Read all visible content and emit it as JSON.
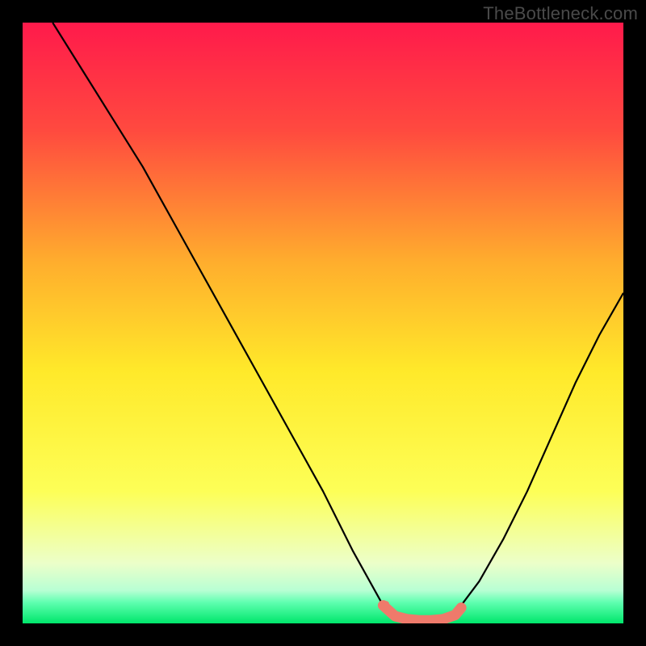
{
  "watermark": "TheBottleneck.com",
  "chart_data": {
    "type": "line",
    "title": "",
    "xlabel": "",
    "ylabel": "",
    "xlim": [
      0,
      100
    ],
    "ylim": [
      0,
      100
    ],
    "grid": false,
    "legend": false,
    "background_gradient": {
      "stops": [
        {
          "offset": 0.0,
          "color": "#ff1a4b"
        },
        {
          "offset": 0.18,
          "color": "#ff4a3f"
        },
        {
          "offset": 0.4,
          "color": "#ffae2d"
        },
        {
          "offset": 0.58,
          "color": "#ffe92a"
        },
        {
          "offset": 0.78,
          "color": "#fdff57"
        },
        {
          "offset": 0.9,
          "color": "#ecffc9"
        },
        {
          "offset": 0.945,
          "color": "#b8ffd4"
        },
        {
          "offset": 0.965,
          "color": "#5fffb0"
        },
        {
          "offset": 1.0,
          "color": "#00e66b"
        }
      ]
    },
    "series": [
      {
        "name": "curve-left",
        "stroke": "#000000",
        "x": [
          5,
          10,
          15,
          20,
          25,
          30,
          35,
          40,
          45,
          50,
          55,
          60
        ],
        "y": [
          100,
          92,
          84,
          76,
          67,
          58,
          49,
          40,
          31,
          22,
          12,
          3
        ]
      },
      {
        "name": "curve-right",
        "stroke": "#000000",
        "x": [
          73,
          76,
          80,
          84,
          88,
          92,
          96,
          100
        ],
        "y": [
          3,
          7,
          14,
          22,
          31,
          40,
          48,
          55
        ]
      },
      {
        "name": "highlight-band",
        "stroke": "#ef7a6b",
        "thick": true,
        "x": [
          60,
          62,
          64,
          66,
          68,
          70,
          72,
          73
        ],
        "y": [
          3,
          1.2,
          0.7,
          0.5,
          0.5,
          0.7,
          1.4,
          2.6
        ]
      }
    ],
    "points": [
      {
        "name": "marker-left",
        "x": 60.5,
        "y": 3.2,
        "color": "#ef7a6b",
        "r": 4
      }
    ]
  }
}
